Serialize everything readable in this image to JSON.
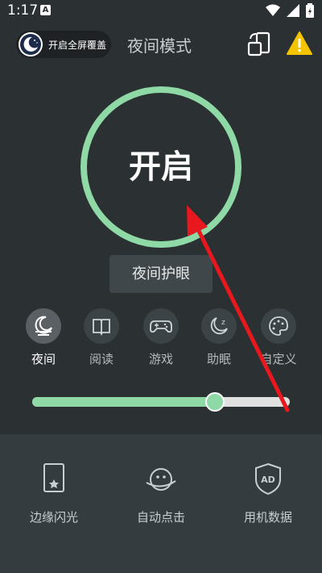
{
  "status": {
    "time": "1:17",
    "badge": "A"
  },
  "header": {
    "pill_label": "开启全屏覆盖",
    "title": "夜间模式"
  },
  "main": {
    "ring_label": "开启",
    "ring_color": "#8ed9a6",
    "eye_button": "夜间护眼"
  },
  "modes": [
    {
      "label": "夜间",
      "icon": "night-icon",
      "active": true
    },
    {
      "label": "阅读",
      "icon": "book-icon",
      "active": false
    },
    {
      "label": "游戏",
      "icon": "gamepad-icon",
      "active": false
    },
    {
      "label": "助眠",
      "icon": "sleep-icon",
      "active": false
    },
    {
      "label": "自定义",
      "icon": "palette-icon",
      "active": false
    }
  ],
  "slider": {
    "fraction": 0.71
  },
  "tools": [
    {
      "label": "边缘闪光",
      "icon": "edge-flash-icon"
    },
    {
      "label": "自动点击",
      "icon": "auto-click-icon"
    },
    {
      "label": "用机数据",
      "icon": "ad-data-icon"
    }
  ],
  "ad_text": "AD",
  "colors": {
    "accent": "#8ed9a6",
    "warning": "#f5c400",
    "arrow": "#e8181e"
  }
}
